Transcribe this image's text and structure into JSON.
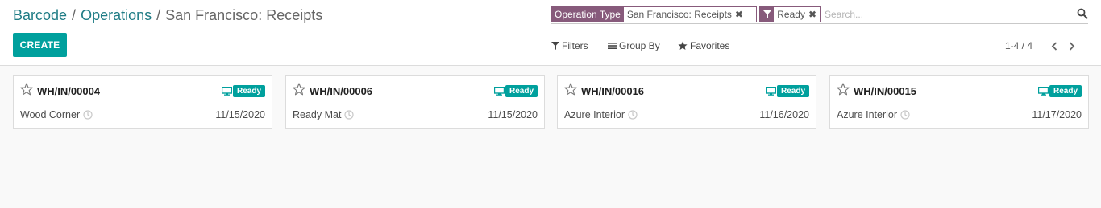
{
  "breadcrumb": {
    "items": [
      "Barcode",
      "Operations"
    ],
    "separator": "/",
    "current": "San Francisco: Receipts"
  },
  "toolbar": {
    "create_label": "CREATE"
  },
  "search": {
    "facets": [
      {
        "label": "Operation Type",
        "value": "San Francisco: Receipts"
      },
      {
        "label": "funnel-icon",
        "value": "Ready"
      }
    ],
    "placeholder": "Search...",
    "filters_label": "Filters",
    "groupby_label": "Group By",
    "favorites_label": "Favorites"
  },
  "pager": {
    "value": "1-4 / 4"
  },
  "cards": [
    {
      "reference": "WH/IN/00004",
      "status": "Ready",
      "partner": "Wood Corner",
      "date": "11/15/2020"
    },
    {
      "reference": "WH/IN/00006",
      "status": "Ready",
      "partner": "Ready Mat",
      "date": "11/15/2020"
    },
    {
      "reference": "WH/IN/00016",
      "status": "Ready",
      "partner": "Azure Interior",
      "date": "11/16/2020"
    },
    {
      "reference": "WH/IN/00015",
      "status": "Ready",
      "partner": "Azure Interior",
      "date": "11/17/2020"
    }
  ],
  "colors": {
    "primary": "#00a09d",
    "facet": "#875a7b",
    "link": "#1f7c85"
  }
}
